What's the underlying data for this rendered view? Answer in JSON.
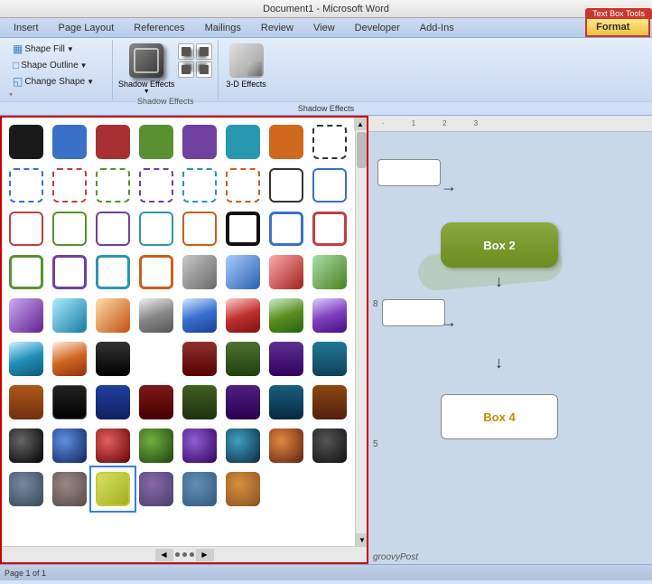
{
  "title_bar": {
    "text": "Document1 - Microsoft Word"
  },
  "tabs": {
    "items": [
      "Insert",
      "Page Layout",
      "References",
      "Mailings",
      "Review",
      "View",
      "Developer",
      "Add-Ins"
    ],
    "context_label": "Text Box Tools",
    "format_label": "Format"
  },
  "ribbon": {
    "shape_fill": "Shape Fill",
    "shape_outline": "Shape Outline",
    "change_shape": "Change Shape",
    "shadow_effects_label": "Shadow Effects",
    "shadow_effects_group": "Shadow Effects",
    "effects_3d_label": "3-D Effects"
  },
  "diagram": {
    "box2_label": "Box 2",
    "box4_label": "Box 4"
  },
  "watermark": "groovyPost",
  "scrollbar": {
    "up": "▲",
    "down": "▼"
  }
}
